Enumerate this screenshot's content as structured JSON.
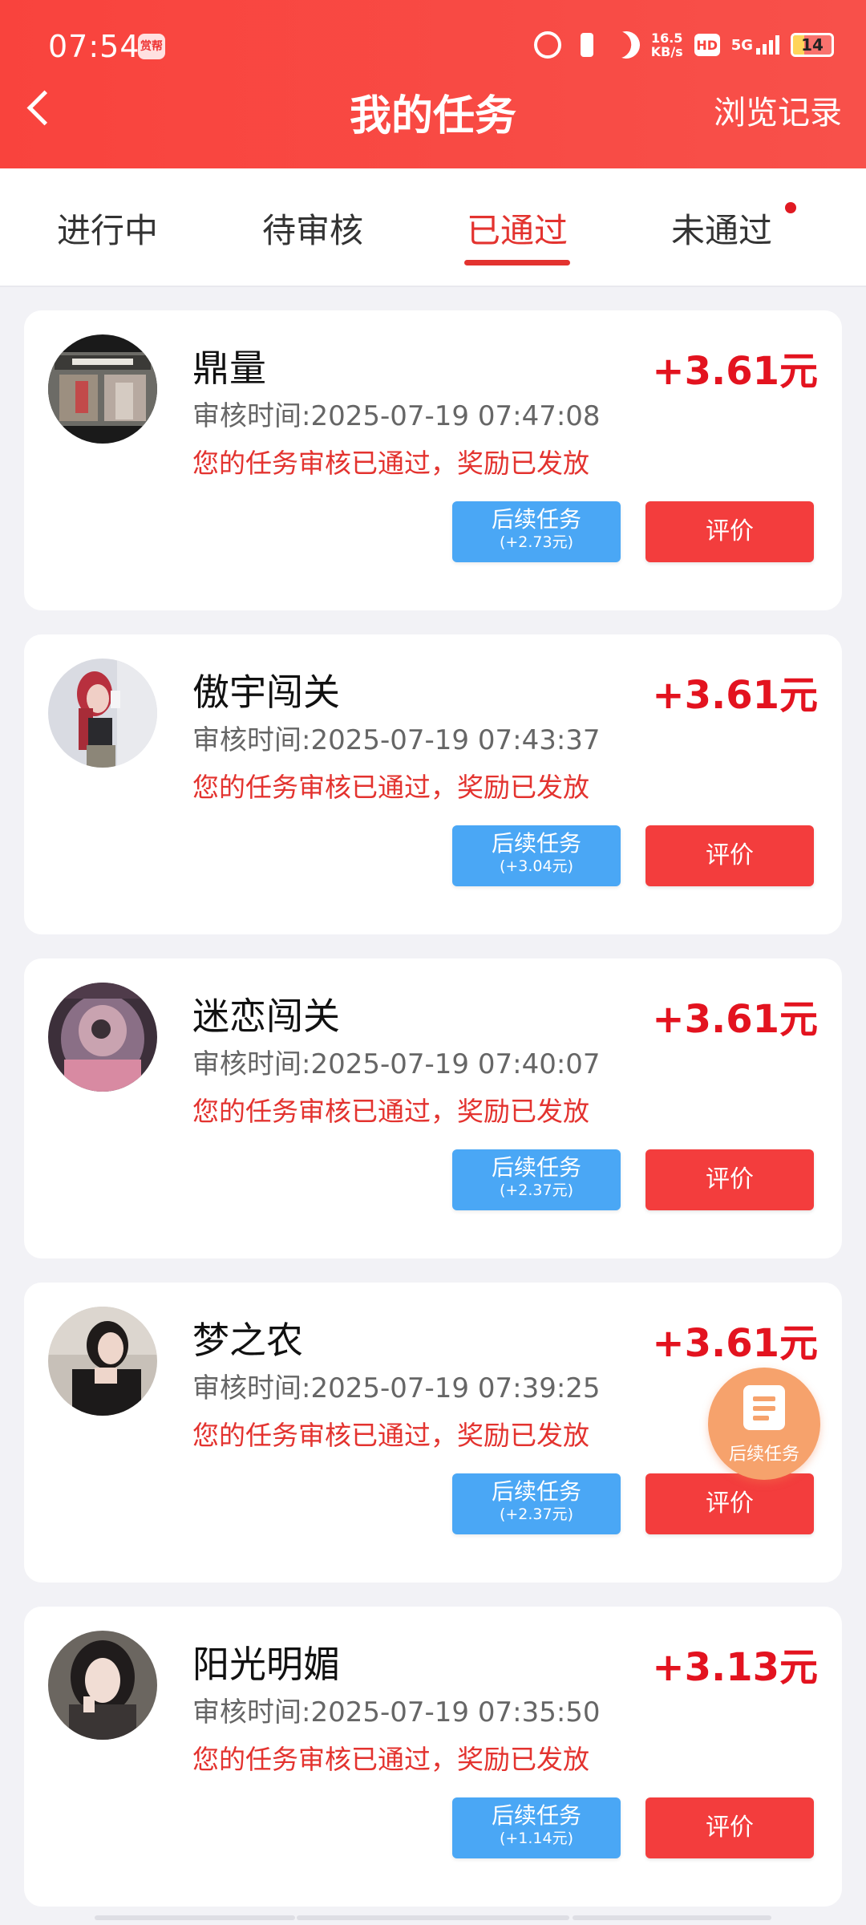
{
  "status_bar": {
    "time": "07:54",
    "app_badge": "赏帮",
    "net_speed": "16.5",
    "net_speed_unit": "KB/s",
    "hd": "HD",
    "signal": "5G",
    "battery": "14"
  },
  "header": {
    "title": "我的任务",
    "history_link": "浏览记录",
    "bg_color": "#f9433d"
  },
  "tabs": [
    {
      "label": "进行中"
    },
    {
      "label": "待审核"
    },
    {
      "label": "已通过"
    },
    {
      "label": "未通过"
    }
  ],
  "active_tab": "已通过",
  "tasks": [
    {
      "name": "鼎量",
      "reward": "+3.61元",
      "review_time": "审核时间:2025-07-19 07:47:08",
      "status": "您的任务审核已通过，奖励已发放",
      "follow_label": "后续任务",
      "follow_bonus": "(+2.73元)",
      "rate_label": "评价"
    },
    {
      "name": "傲宇闯关",
      "reward": "+3.61元",
      "review_time": "审核时间:2025-07-19 07:43:37",
      "status": "您的任务审核已通过，奖励已发放",
      "follow_label": "后续任务",
      "follow_bonus": "(+3.04元)",
      "rate_label": "评价"
    },
    {
      "name": "迷恋闯关",
      "reward": "+3.61元",
      "review_time": "审核时间:2025-07-19 07:40:07",
      "status": "您的任务审核已通过，奖励已发放",
      "follow_label": "后续任务",
      "follow_bonus": "(+2.37元)",
      "rate_label": "评价"
    },
    {
      "name": "梦之农",
      "reward": "+3.61元",
      "review_time": "审核时间:2025-07-19 07:39:25",
      "status": "您的任务审核已通过，奖励已发放",
      "follow_label": "后续任务",
      "follow_bonus": "(+2.37元)",
      "rate_label": "评价"
    },
    {
      "name": "阳光明媚",
      "reward": "+3.13元",
      "review_time": "审核时间:2025-07-19 07:35:50",
      "status": "您的任务审核已通过，奖励已发放",
      "follow_label": "后续任务",
      "follow_bonus": "(+1.14元)",
      "rate_label": "评价"
    }
  ],
  "fab": {
    "label": "后续任务",
    "icon": "document-list-icon"
  },
  "colors": {
    "accent_red": "#e3332f",
    "reward_red": "#e3131f",
    "follow_button_blue": "#4aa7f5",
    "rate_button_red": "#f33d3d",
    "fab_orange": "#f6a26c"
  }
}
